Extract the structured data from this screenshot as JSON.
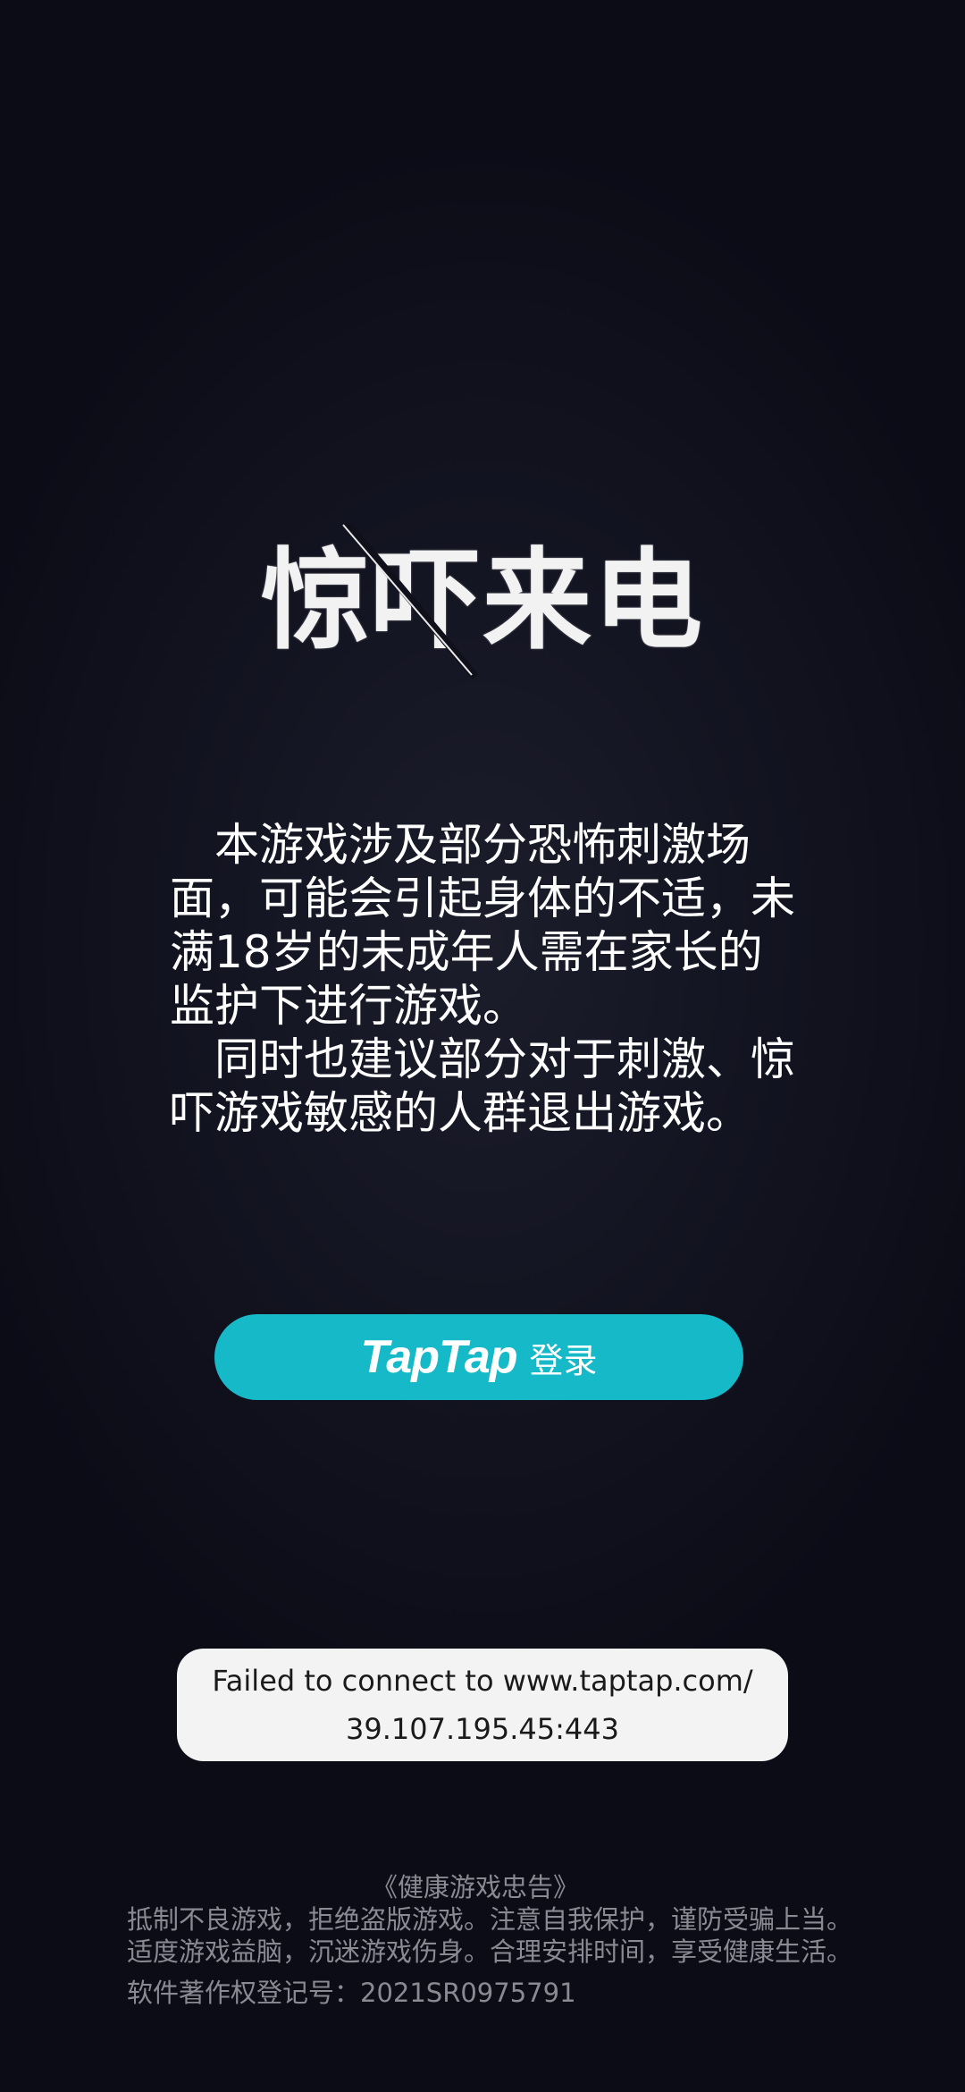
{
  "logo": {
    "title": "惊吓来电"
  },
  "warning": {
    "paragraph_1": "　本游戏涉及部分恐怖刺激场面，可能会引起身体的不适，未满18岁的未成年人需在家长的监护下进行游戏。",
    "paragraph_2": "　同时也建议部分对于刺激、惊吓游戏敏感的人群退出游戏。"
  },
  "login": {
    "brand": "TapTap",
    "label": "登录",
    "color": "#15b9c8"
  },
  "toast": {
    "line_1": "Failed to connect to www.taptap.com/",
    "line_2": "39.107.195.45:443"
  },
  "footer": {
    "notice_title": "《健康游戏忠告》",
    "notice_line_1": "抵制不良游戏，拒绝盗版游戏。注意自我保护，谨防受骗上当。",
    "notice_line_2": "适度游戏益脑，沉迷游戏伤身。合理安排时间，享受健康生活。",
    "registration": "软件著作权登记号：2021SR0975791"
  }
}
